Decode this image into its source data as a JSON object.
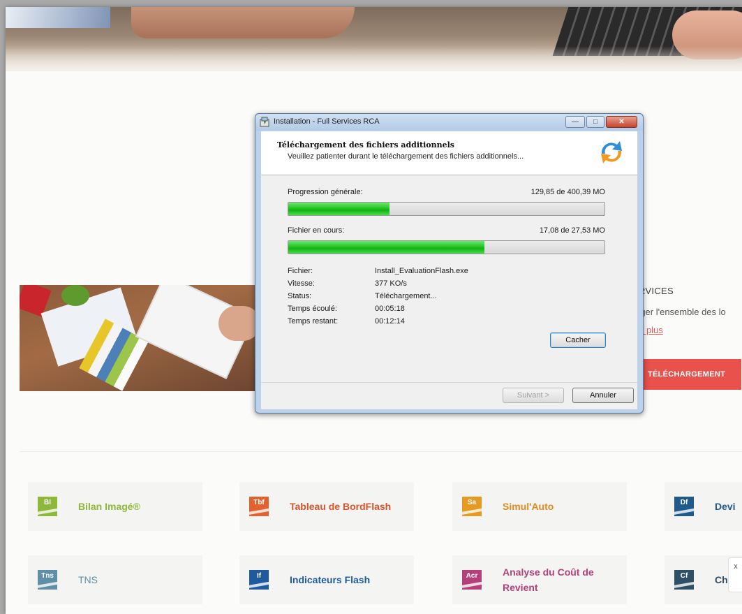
{
  "installer": {
    "window_title": "Installation - Full Services RCA",
    "heading": "Téléchargement des fichiers additionnels",
    "subheading": "Veuillez patienter durant le téléchargement des fichiers additionnels...",
    "overall_label": "Progression générale:",
    "overall_value": "129,85 de 400,39 MO",
    "overall_progress": 0.32,
    "current_label": "Fichier en cours:",
    "current_value": "17,08 de 27,53 MO",
    "current_progress": 0.62,
    "details": [
      {
        "label": "Fichier:",
        "value": "Install_EvaluationFlash.exe"
      },
      {
        "label": "Vitesse:",
        "value": "377 KO/s"
      },
      {
        "label": "Status:",
        "value": "Téléchargement..."
      },
      {
        "label": "Temps écoulé:",
        "value": "00:05:18"
      },
      {
        "label": "Temps restant:",
        "value": "00:12:14"
      }
    ],
    "hide_button": "Cacher",
    "next_button": "Suivant >",
    "cancel_button": "Annuler"
  },
  "service": {
    "title": "RVICES",
    "description": "rger l'ensemble des lo",
    "more_link": "r plus",
    "download_button": "TÉLÉCHARGEMENT"
  },
  "products": [
    {
      "abbr": "BI",
      "name": "Bilan Imagé®",
      "icon_color": "#8db83a",
      "text_color": "#8db83a"
    },
    {
      "abbr": "Tbf",
      "name": "Tableau de BordFlash",
      "icon_color": "#e3602f",
      "text_color": "#d9542a"
    },
    {
      "abbr": "Sa",
      "name": "Simul'Auto",
      "icon_color": "#e79a22",
      "text_color": "#e08b1f"
    },
    {
      "abbr": "Df",
      "name": "Devi",
      "icon_color": "#1f5a8a",
      "text_color": "#1f5a8a"
    },
    {
      "abbr": "Tns",
      "name": "TNS",
      "icon_color": "#5f8fa7",
      "text_color": "#5f8fa7"
    },
    {
      "abbr": "If",
      "name": "Indicateurs Flash",
      "icon_color": "#1e5a9e",
      "text_color": "#1e5a9e"
    },
    {
      "abbr": "Acr",
      "name": "Analyse du Coût de Revient",
      "icon_color": "#b43f7b",
      "text_color": "#b43f7b"
    },
    {
      "abbr": "Cf",
      "name": "Ch",
      "icon_color": "#2f4f66",
      "text_color": "#2f4f66"
    }
  ],
  "chat_widget": {
    "close_glyph": "x"
  }
}
